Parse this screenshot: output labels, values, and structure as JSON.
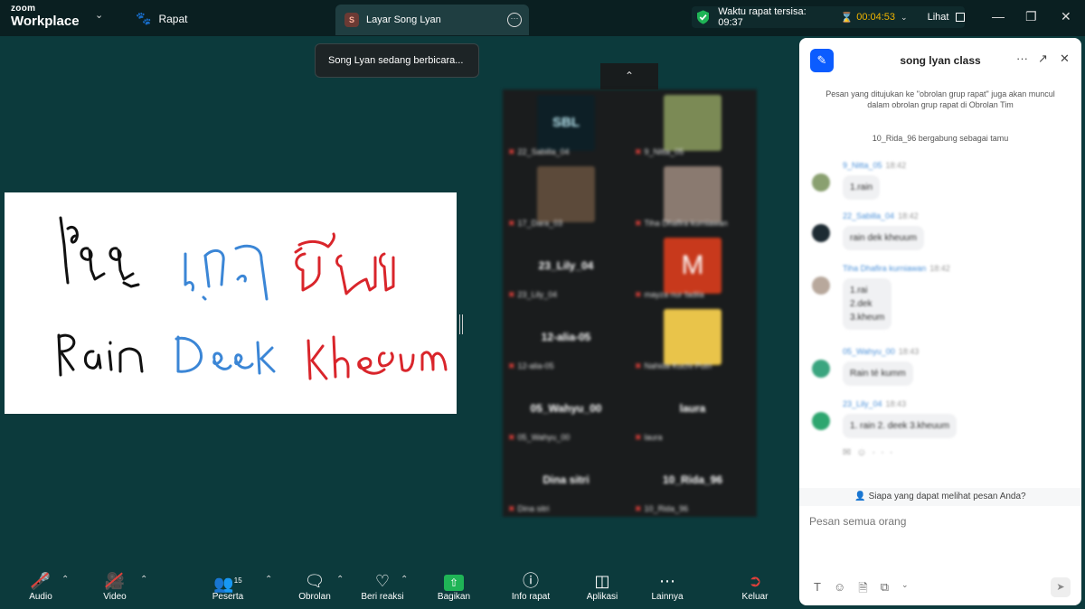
{
  "app": {
    "brand_top": "zoom",
    "brand_bottom": "Workplace",
    "meeting_label": "Rapat"
  },
  "share_tab": {
    "badge": "S",
    "label": "Layar Song Lyan"
  },
  "timer": {
    "remaining_label": "Waktu rapat tersisa: 09:37",
    "elapsed": "00:04:53",
    "view_label": "Lihat"
  },
  "toast": "Song Lyan sedang berbicara...",
  "colors": {
    "accent": "#0b5cff",
    "share_green": "#1fb456",
    "timer_amber": "#f0b400",
    "muted_red": "#e0403a"
  },
  "shared_screen": {
    "line1_parts": [
      "ไรร",
      "เดก",
      "คึม"
    ],
    "line2_parts": [
      "Rain",
      "Deek",
      "Kheum"
    ],
    "colors": [
      "#111111",
      "#3b86d6",
      "#d9252b"
    ]
  },
  "gallery": {
    "tiles": [
      {
        "name": "22_Sabilla_04",
        "kind": "thumb",
        "color": "#0d1f26",
        "thumb_text": "SBL"
      },
      {
        "name": "9_Nitta_05",
        "kind": "thumb",
        "color": "#7b8a55"
      },
      {
        "name": "17_Dara_03",
        "kind": "thumb",
        "color": "#5c4a3a"
      },
      {
        "name": "Tiha Dhafira kurniawan",
        "kind": "thumb",
        "color": "#8a7a70"
      },
      {
        "name": "23_Lily_04",
        "kind": "name",
        "big": "23_Lily_04"
      },
      {
        "name": "mayza nur fadila",
        "kind": "thumb",
        "color": "#c8391c",
        "thumb_text": "M"
      },
      {
        "name": "12-alia-05",
        "kind": "name",
        "big": "12-alia-05"
      },
      {
        "name": "Nahida Kuchi Putri",
        "kind": "thumb",
        "color": "#e9c44a"
      },
      {
        "name": "05_Wahyu_00",
        "kind": "name",
        "big": "05_Wahyu_00"
      },
      {
        "name": "laura",
        "kind": "name",
        "big": "laura"
      },
      {
        "name": "Dina sitri",
        "kind": "name",
        "big": "Dina sitri"
      },
      {
        "name": "10_Rida_96",
        "kind": "name",
        "big": "10_Rida_96"
      }
    ]
  },
  "chat": {
    "title": "song lyan class",
    "notice": "Pesan yang ditujukan ke \"obrolan grup rapat\" juga akan muncul dalam obrolan grup rapat di Obrolan Tim",
    "join_notice": "10_Rida_96 bergabung sebagai tamu",
    "messages": [
      {
        "sender": "9_Nitta_05",
        "time": "18:42",
        "text": "1.rain",
        "avatar": "#8aa070"
      },
      {
        "sender": "22_Sabilla_04",
        "time": "18:42",
        "text": "rain dek kheuum",
        "avatar": "#1d2b33"
      },
      {
        "sender": "Tiha Dhafira kurniawan",
        "time": "18:42",
        "text_lines": [
          "1.rai",
          "2.dek",
          "3.kheum"
        ],
        "avatar": "#b8a89c"
      },
      {
        "sender": "05_Wahyu_00",
        "time": "18:43",
        "text": "Rain té kumm",
        "avatar": "#3aa57f"
      },
      {
        "sender": "23_Lily_04",
        "time": "18:43",
        "text": "1. rain 2. deek 3.kheuum",
        "avatar": "#2ea66f"
      }
    ],
    "who_can_see": "Siapa yang dapat melihat pesan Anda?",
    "input_placeholder": "Pesan semua orang"
  },
  "toolbar": {
    "audio": "Audio",
    "video": "Video",
    "participants": "Peserta",
    "participants_count": "15",
    "chat": "Obrolan",
    "react": "Beri reaksi",
    "share": "Bagikan",
    "info": "Info rapat",
    "apps": "Aplikasi",
    "more": "Lainnya",
    "leave": "Keluar"
  }
}
